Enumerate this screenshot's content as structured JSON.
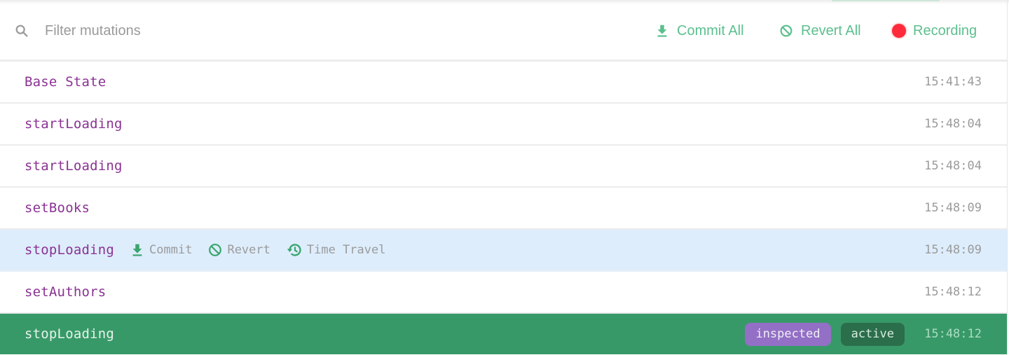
{
  "toolbar": {
    "search_placeholder": "Filter mutations",
    "search_value": "",
    "commit_all_label": "Commit All",
    "revert_all_label": "Revert All",
    "recording_label": "Recording"
  },
  "colors": {
    "accent": "#5cbf8e",
    "mutation_name": "#8a3293",
    "active_row_bg": "#389968",
    "hover_row_bg": "#ddedfc",
    "recording_dot": "#ff2a3a",
    "inspected_badge": "#946fc6",
    "active_badge": "#2b6e4b"
  },
  "row_actions": {
    "commit_label": "Commit",
    "revert_label": "Revert",
    "time_travel_label": "Time Travel"
  },
  "mutations": [
    {
      "name": "Base State",
      "time": "15:41:43"
    },
    {
      "name": "startLoading",
      "time": "15:48:04"
    },
    {
      "name": "startLoading",
      "time": "15:48:04"
    },
    {
      "name": "setBooks",
      "time": "15:48:09"
    },
    {
      "name": "stopLoading",
      "time": "15:48:09",
      "state": "hover"
    },
    {
      "name": "setAuthors",
      "time": "15:48:12"
    },
    {
      "name": "stopLoading",
      "time": "15:48:12",
      "state": "active",
      "badges": [
        "inspected",
        "active"
      ]
    }
  ]
}
